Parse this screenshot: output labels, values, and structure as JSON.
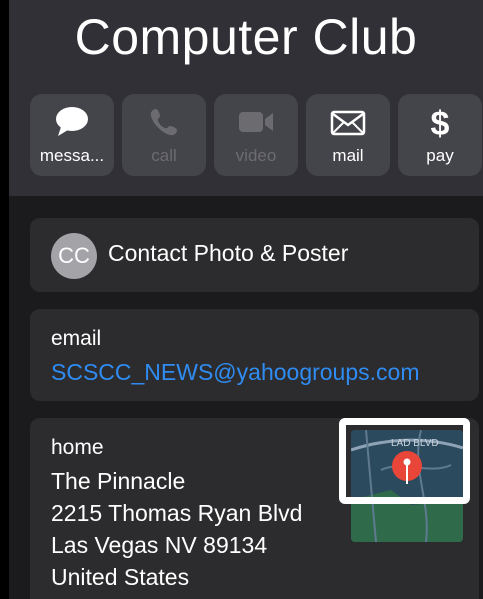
{
  "contact": {
    "name": "Computer Club"
  },
  "actions": [
    {
      "label": "messa...",
      "icon": "message-bubble-icon",
      "enabled": true
    },
    {
      "label": "call",
      "icon": "phone-icon",
      "enabled": false
    },
    {
      "label": "video",
      "icon": "video-camera-icon",
      "enabled": false
    },
    {
      "label": "mail",
      "icon": "envelope-icon",
      "enabled": true
    },
    {
      "label": "pay",
      "icon": "dollar-icon",
      "enabled": true
    }
  ],
  "contact_photo": {
    "initials": "CC",
    "label": "Contact Photo & Poster"
  },
  "email": {
    "label": "email",
    "value": "SCSCC_NEWS@yahoogroups.com"
  },
  "address": {
    "label": "home",
    "lines": [
      "The Pinnacle",
      "2215 Thomas Ryan Blvd",
      "Las Vegas NV 89134",
      "United States"
    ],
    "map_street_label": "LAD BLVD"
  },
  "colors": {
    "link": "#2f8cf2",
    "pin": "#e9463a",
    "card": "#2c2c2e",
    "header": "#303036"
  }
}
